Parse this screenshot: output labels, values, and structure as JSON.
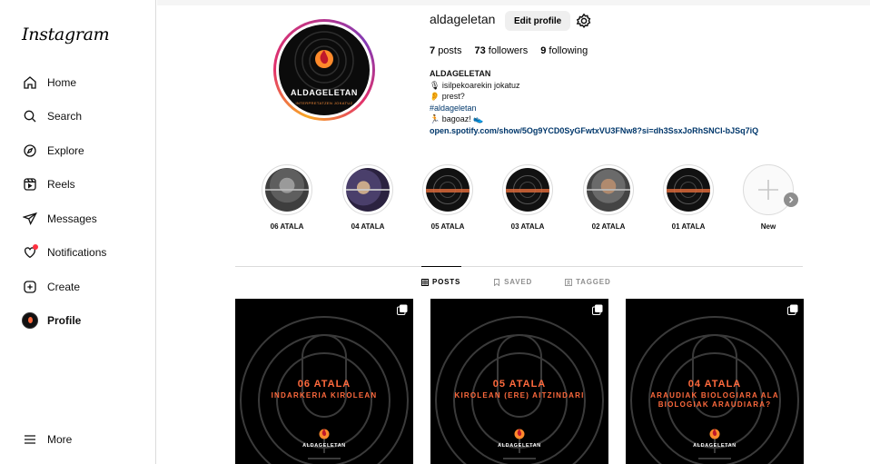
{
  "sidebar": {
    "logo": "Instagram",
    "items": [
      {
        "label": "Home",
        "icon": "home-icon"
      },
      {
        "label": "Search",
        "icon": "search-icon"
      },
      {
        "label": "Explore",
        "icon": "compass-icon"
      },
      {
        "label": "Reels",
        "icon": "reels-icon"
      },
      {
        "label": "Messages",
        "icon": "send-icon"
      },
      {
        "label": "Notifications",
        "icon": "heart-icon"
      },
      {
        "label": "Create",
        "icon": "plus-square-icon"
      },
      {
        "label": "Profile",
        "icon": "avatar"
      }
    ],
    "more_label": "More"
  },
  "profile": {
    "username": "aldageletan",
    "edit_label": "Edit profile",
    "posts_count": "7",
    "posts_label": "posts",
    "followers_count": "73",
    "followers_label": "followers",
    "following_count": "9",
    "following_label": "following",
    "avatar_text": "ALDAGELETAN",
    "avatar_sub": "INTERPRETATZEN JOKATUZ",
    "bio": {
      "name": "ALDAGELETAN",
      "line1": "🎙 isilpekoarekin jokatuz",
      "line2": "👂 prest?",
      "hashtag": "#aldageletan",
      "line4": "🏃 bagoaz! 👟",
      "link": "open.spotify.com/show/5Og9YCD0SyGFwtxVU3FNw8?si=dh3SsxJoRhSNCl-bJSq7iQ"
    }
  },
  "highlights": [
    {
      "label": "06 ATALA",
      "style": "photo"
    },
    {
      "label": "04 ATALA",
      "style": "photo2"
    },
    {
      "label": "05 ATALA",
      "style": "dark"
    },
    {
      "label": "03 ATALA",
      "style": "dark"
    },
    {
      "label": "02 ATALA",
      "style": "photo3"
    },
    {
      "label": "01 ATALA",
      "style": "dark"
    },
    {
      "label": "New",
      "style": "new"
    }
  ],
  "tabs": [
    {
      "label": "POSTS",
      "active": true
    },
    {
      "label": "SAVED",
      "active": false
    },
    {
      "label": "TAGGED",
      "active": false
    }
  ],
  "posts": [
    {
      "line1": "06 ATALA",
      "line2": "INDARKERIA KIROLEAN",
      "line3": "",
      "brand": "ALDAGELETAN"
    },
    {
      "line1": "05 ATALA",
      "line2": "KIROLEAN (ERE) AITZINDARI",
      "line3": "",
      "brand": "ALDAGELETAN"
    },
    {
      "line1": "04 ATALA",
      "line2": "ARAUDIAK BIOLOGIARA ALA",
      "line3": "BIOLOGIAK ARAUDIARA?",
      "brand": "ALDAGELETAN"
    }
  ],
  "colors": {
    "accent_orange": "#ff6a3d",
    "link_blue": "#00376b",
    "muted_gray": "#8e8e8e"
  }
}
